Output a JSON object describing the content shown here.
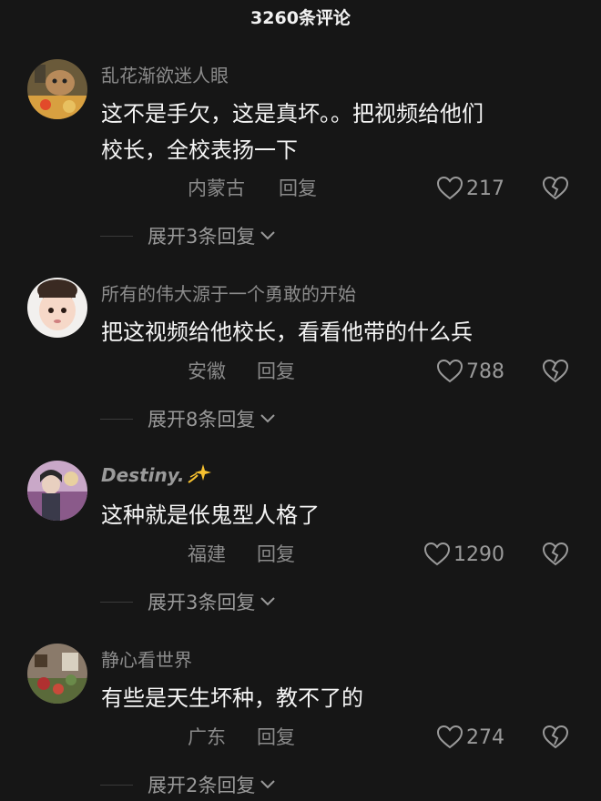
{
  "header": {
    "title": "3260条评论"
  },
  "comments": [
    {
      "username": "乱花渐欲迷人眼",
      "lines": [
        "这不是手欠，这是真坏。。把视频给他们",
        "校长，全校表扬一下"
      ],
      "location": "内蒙古",
      "reply_label": "回复",
      "likes": "217",
      "expand_label": "展开3条回复"
    },
    {
      "username": "所有的伟大源于一个勇敢的开始",
      "lines": [
        "把这视频给他校长，看看他带的什么兵"
      ],
      "location": "安徽",
      "reply_label": "回复",
      "likes": "788",
      "expand_label": "展开8条回复"
    },
    {
      "username": "Destiny.",
      "lines": [
        "这种就是伥鬼型人格了"
      ],
      "location": "福建",
      "reply_label": "回复",
      "likes": "1290",
      "expand_label": "展开3条回复"
    },
    {
      "username": "静心看世界",
      "lines": [
        "有些是天生坏种，教不了的"
      ],
      "location": "广东",
      "reply_label": "回复",
      "likes": "274",
      "expand_label": "展开2条回复"
    }
  ],
  "colors": {
    "background": "#161616",
    "username": "#8c8c8c",
    "text": "#f5f5f5",
    "meta": "#8a8a8a"
  },
  "icons": [
    "heart-icon",
    "broken-heart-icon",
    "chevron-down-icon",
    "sparkle-icon"
  ]
}
